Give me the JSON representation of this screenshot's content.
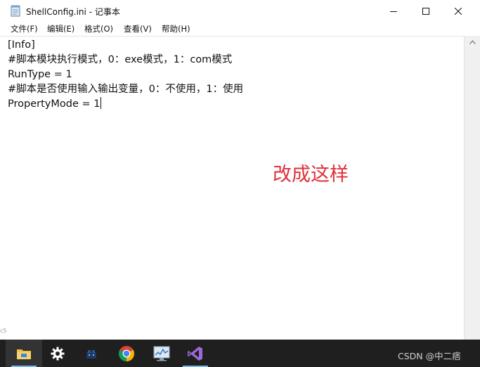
{
  "window": {
    "title": "ShellConfig.ini - 记事本"
  },
  "menubar": {
    "items": [
      {
        "label": "文件(F)"
      },
      {
        "label": "编辑(E)"
      },
      {
        "label": "格式(O)"
      },
      {
        "label": "查看(V)"
      },
      {
        "label": "帮助(H)"
      }
    ]
  },
  "editor": {
    "lines": [
      "[Info]",
      "#脚本模块执行模式，0：exe模式，1：com模式",
      "RunType = 1",
      "#脚本是否使用输入输出变量，0：不使用，1：使用",
      "PropertyMode = 1"
    ]
  },
  "annotation": {
    "text": "改成这样",
    "color": "#e0303a"
  },
  "taskbar": {
    "icons": [
      "file-explorer-icon",
      "settings-icon",
      "app-icon",
      "chrome-icon",
      "performance-monitor-icon",
      "visual-studio-icon"
    ],
    "accent": "#76b9ed"
  },
  "watermark": {
    "text": "CSDN @中二痞"
  },
  "side_mark": {
    "text": "c5"
  }
}
